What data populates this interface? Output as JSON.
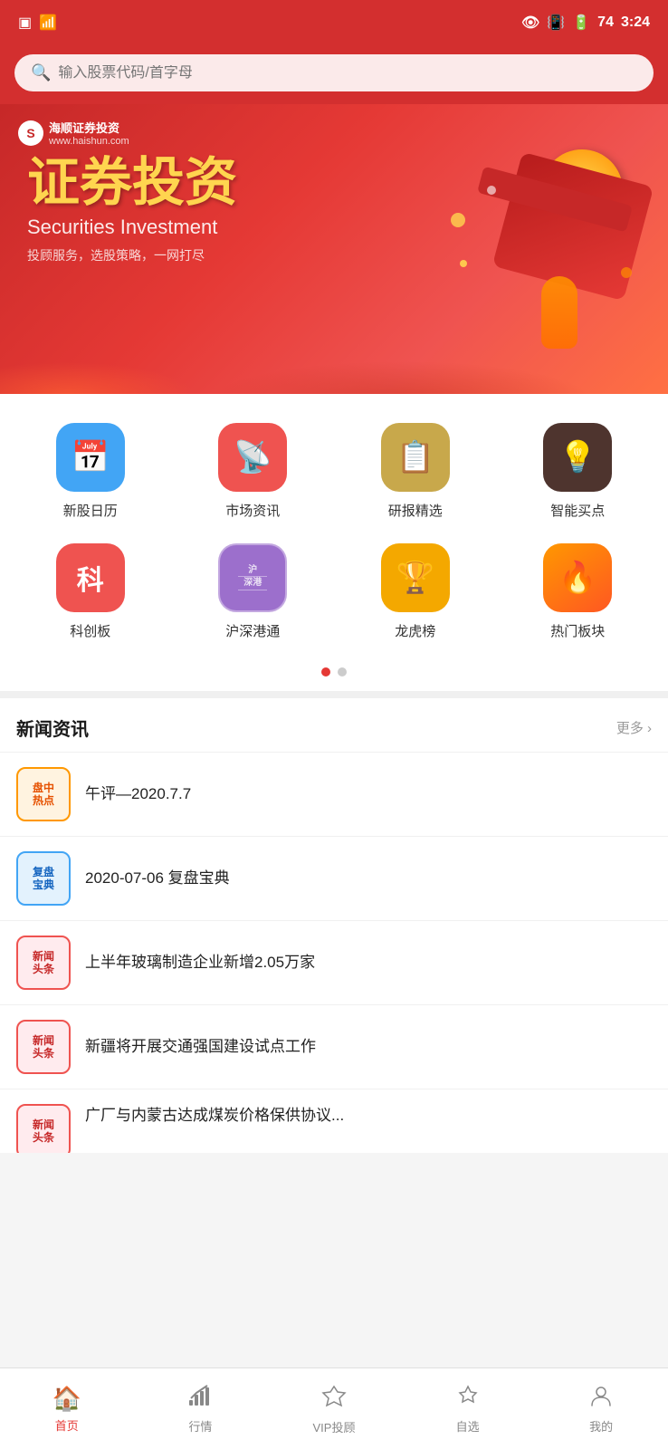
{
  "statusBar": {
    "time": "3:24",
    "battery": "74"
  },
  "search": {
    "placeholder": "输入股票代码/首字母"
  },
  "banner": {
    "logo_name": "海顺证券投资",
    "logo_url": "www.haishun.com",
    "title": "证券投资",
    "subtitle": "Securities Investment",
    "slogan": "投顾服务，选股策略，一网打尽",
    "coin_symbol": "¥"
  },
  "iconGrid": {
    "row1": [
      {
        "id": "new-stock-calendar",
        "label": "新股日历",
        "colorClass": "ic-blue",
        "icon": "📅"
      },
      {
        "id": "market-news",
        "label": "市场资讯",
        "colorClass": "ic-pink",
        "icon": "📡"
      },
      {
        "id": "research-picks",
        "label": "研报精选",
        "colorClass": "ic-gold",
        "icon": "📋"
      },
      {
        "id": "smart-buy",
        "label": "智能买点",
        "colorClass": "ic-dark",
        "icon": "💡"
      }
    ],
    "row2": [
      {
        "id": "star-market",
        "label": "科创板",
        "colorClass": "ic-red-text",
        "icon": "科"
      },
      {
        "id": "hk-connect",
        "label": "沪深港通",
        "colorClass": "ic-purple",
        "icon": "🏛"
      },
      {
        "id": "dragon-tiger",
        "label": "龙虎榜",
        "colorClass": "ic-orange-gold",
        "icon": "🏆"
      },
      {
        "id": "hot-sectors",
        "label": "热门板块",
        "colorClass": "ic-orange-fire",
        "icon": "🔥"
      }
    ]
  },
  "pagination": {
    "active": 0,
    "total": 2
  },
  "newsSection": {
    "title": "新闻资讯",
    "more_label": "更多 ›",
    "items": [
      {
        "id": "news-1",
        "badge_text": "盘中\n热点",
        "badge_style": "badge-orange",
        "text": "午评—2020.7.7"
      },
      {
        "id": "news-2",
        "badge_text": "复盘\n宝典",
        "badge_style": "badge-blue",
        "text": "2020-07-06 复盘宝典"
      },
      {
        "id": "news-3",
        "badge_text": "新闻\n头条",
        "badge_style": "badge-red",
        "text": "上半年玻璃制造企业新增2.05万家"
      },
      {
        "id": "news-4",
        "badge_text": "新闻\n头条",
        "badge_style": "badge-red",
        "text": "新疆将开展交通强国建设试点工作"
      },
      {
        "id": "news-5",
        "badge_text": "新闻\n头条",
        "badge_style": "badge-red",
        "text": "广厂与内蒙古达成煤炭价格保供协议..."
      }
    ]
  },
  "bottomNav": {
    "items": [
      {
        "id": "home",
        "label": "首页",
        "icon": "🏠",
        "active": true
      },
      {
        "id": "market",
        "label": "行情",
        "icon": "📈",
        "active": false
      },
      {
        "id": "vip",
        "label": "VIP投顾",
        "icon": "💎",
        "active": false
      },
      {
        "id": "watchlist",
        "label": "自选",
        "icon": "⭐",
        "active": false
      },
      {
        "id": "profile",
        "label": "我的",
        "icon": "👤",
        "active": false
      }
    ]
  }
}
